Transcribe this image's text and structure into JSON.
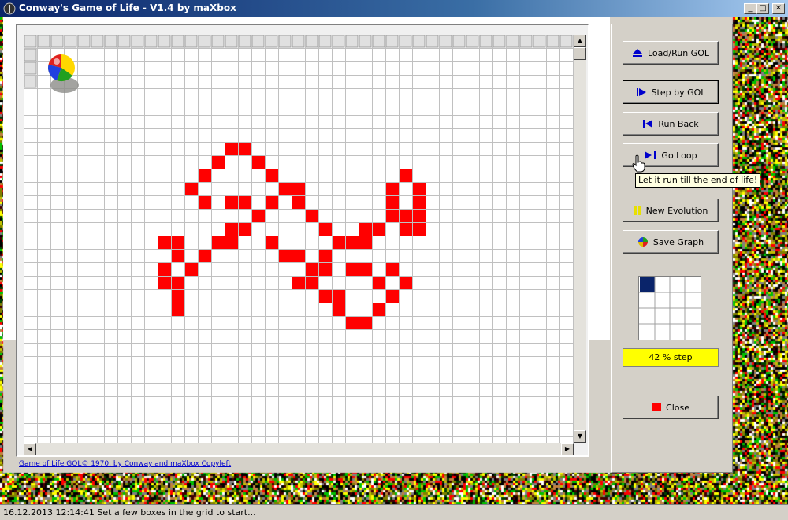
{
  "window": {
    "title": "Conway's Game of Life - V1.4 by maXbox",
    "minimize_glyph": "_",
    "maximize_glyph": "□",
    "close_glyph": "✕"
  },
  "grid": {
    "cols": 43,
    "rows": 30,
    "live_color": "#ff0000",
    "line_color": "#c0c0c0",
    "live_cells": [
      [
        15,
        8
      ],
      [
        16,
        8
      ],
      [
        14,
        9
      ],
      [
        17,
        9
      ],
      [
        13,
        10
      ],
      [
        18,
        10
      ],
      [
        28,
        10
      ],
      [
        12,
        11
      ],
      [
        19,
        11
      ],
      [
        20,
        11
      ],
      [
        27,
        11
      ],
      [
        29,
        11
      ],
      [
        13,
        12
      ],
      [
        15,
        12
      ],
      [
        16,
        12
      ],
      [
        18,
        12
      ],
      [
        20,
        12
      ],
      [
        27,
        12
      ],
      [
        29,
        12
      ],
      [
        17,
        13
      ],
      [
        21,
        13
      ],
      [
        27,
        13
      ],
      [
        28,
        13
      ],
      [
        29,
        13
      ],
      [
        15,
        14
      ],
      [
        16,
        14
      ],
      [
        22,
        14
      ],
      [
        25,
        14
      ],
      [
        26,
        14
      ],
      [
        28,
        14
      ],
      [
        29,
        14
      ],
      [
        10,
        15
      ],
      [
        11,
        15
      ],
      [
        14,
        15
      ],
      [
        15,
        15
      ],
      [
        18,
        15
      ],
      [
        23,
        15
      ],
      [
        24,
        15
      ],
      [
        25,
        15
      ],
      [
        11,
        16
      ],
      [
        13,
        16
      ],
      [
        19,
        16
      ],
      [
        20,
        16
      ],
      [
        22,
        16
      ],
      [
        10,
        17
      ],
      [
        12,
        17
      ],
      [
        21,
        17
      ],
      [
        22,
        17
      ],
      [
        24,
        17
      ],
      [
        25,
        17
      ],
      [
        27,
        17
      ],
      [
        10,
        18
      ],
      [
        11,
        18
      ],
      [
        20,
        18
      ],
      [
        21,
        18
      ],
      [
        26,
        18
      ],
      [
        28,
        18
      ],
      [
        11,
        19
      ],
      [
        22,
        19
      ],
      [
        23,
        19
      ],
      [
        27,
        19
      ],
      [
        11,
        20
      ],
      [
        23,
        20
      ],
      [
        26,
        20
      ],
      [
        24,
        21
      ],
      [
        25,
        21
      ]
    ]
  },
  "buttons": {
    "load_run": "Load/Run GOL",
    "step": "Step by GOL",
    "run_back": "Run Back",
    "go_loop": "Go Loop",
    "new_evolution": "New Evolution",
    "save_graph": "Save Graph",
    "close": "Close"
  },
  "tooltip": "Let it run till the end of life!",
  "progress": {
    "text": "42 % step",
    "color": "#ffff00"
  },
  "credit": "Game of Life GOL© 1970, by Conway and maXbox Copyleft",
  "status": "16.12.2013 12:14:41 Set a few boxes in the grid to start...",
  "colors": {
    "accent_blue": "#0000cc",
    "mini_cell": "#0a246a",
    "close_red": "#ff0000"
  }
}
